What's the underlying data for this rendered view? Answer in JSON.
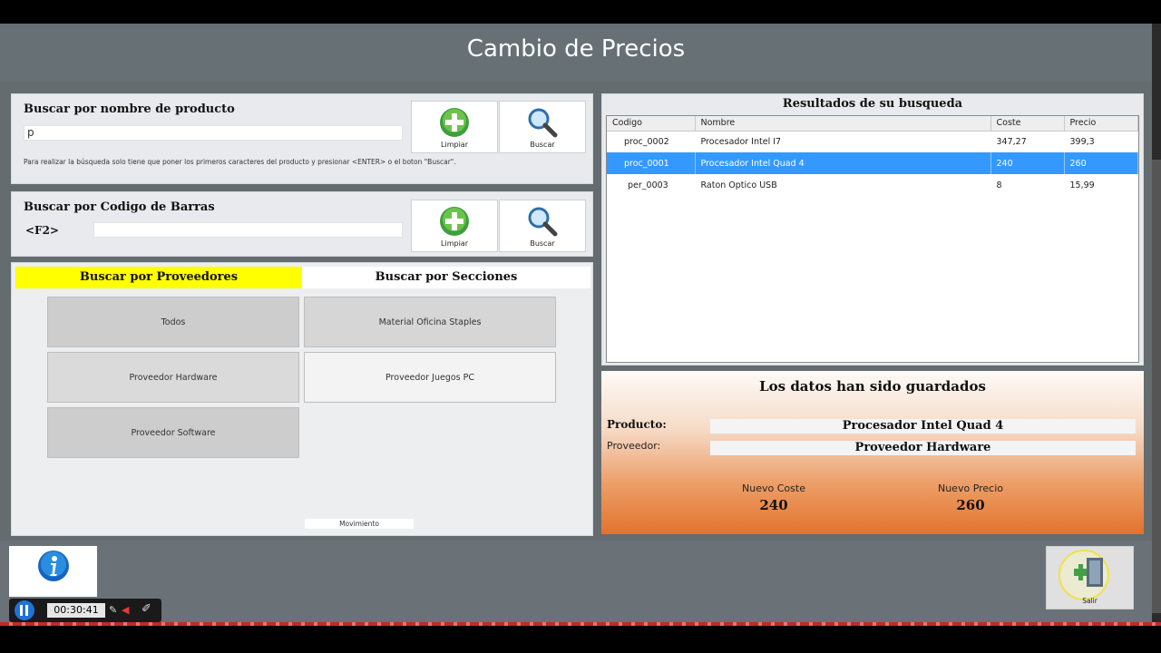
{
  "app": {
    "title": "Cambio de Precios"
  },
  "search_name": {
    "label": "Buscar por nombre de producto",
    "value": "p",
    "hint": "Para realizar la búsqueda solo tiene que poner los primeros caracteres del producto y presionar <ENTER> o el boton \"Buscar\".",
    "clear_label": "Limpiar",
    "search_label": "Buscar"
  },
  "search_barcode": {
    "label": "Buscar por Codigo de Barras",
    "shortcut": "<F2>",
    "value": "",
    "clear_label": "Limpiar",
    "search_label": "Buscar"
  },
  "tabs": [
    {
      "label": "Buscar por Proveedores",
      "active": true
    },
    {
      "label": "Buscar por Secciones",
      "active": false
    }
  ],
  "suppliers": [
    {
      "label": "Todos"
    },
    {
      "label": "Material Oficina Staples"
    },
    {
      "label": "Proveedor Hardware"
    },
    {
      "label": "Proveedor Juegos PC"
    },
    {
      "label": "Proveedor Software"
    }
  ],
  "movement_label": "Movimiento",
  "results": {
    "title": "Resultados de su busqueda",
    "columns": [
      "Codigo",
      "Nombre",
      "Coste",
      "Precio"
    ],
    "rows": [
      {
        "codigo": "proc_0002",
        "nombre": "Procesador Intel I7",
        "coste": "347,27",
        "precio": "399,3"
      },
      {
        "codigo": "proc_0001",
        "nombre": "Procesador Intel Quad 4",
        "coste": "240",
        "precio": "260"
      },
      {
        "codigo": "per_0003",
        "nombre": "Raton Optico USB",
        "coste": "8",
        "precio": "15,99"
      }
    ],
    "selected_index": 1
  },
  "saved": {
    "message": "Los datos han sido guardados",
    "producto_label": "Producto:",
    "producto_value": "Procesador Intel Quad 4",
    "proveedor_label": "Proveedor:",
    "proveedor_value": "Proveedor Hardware",
    "nuevo_coste_label": "Nuevo Coste",
    "nuevo_coste_value": "240",
    "nuevo_precio_label": "Nuevo Precio",
    "nuevo_precio_value": "260"
  },
  "footer": {
    "exit_label": "Salir"
  },
  "video": {
    "time": "00:30:41"
  },
  "colors": {
    "accent_tab": "#ffff00",
    "selection": "#3399ff",
    "plus_green": "#4caf50",
    "info_blue": "#1565c0"
  }
}
